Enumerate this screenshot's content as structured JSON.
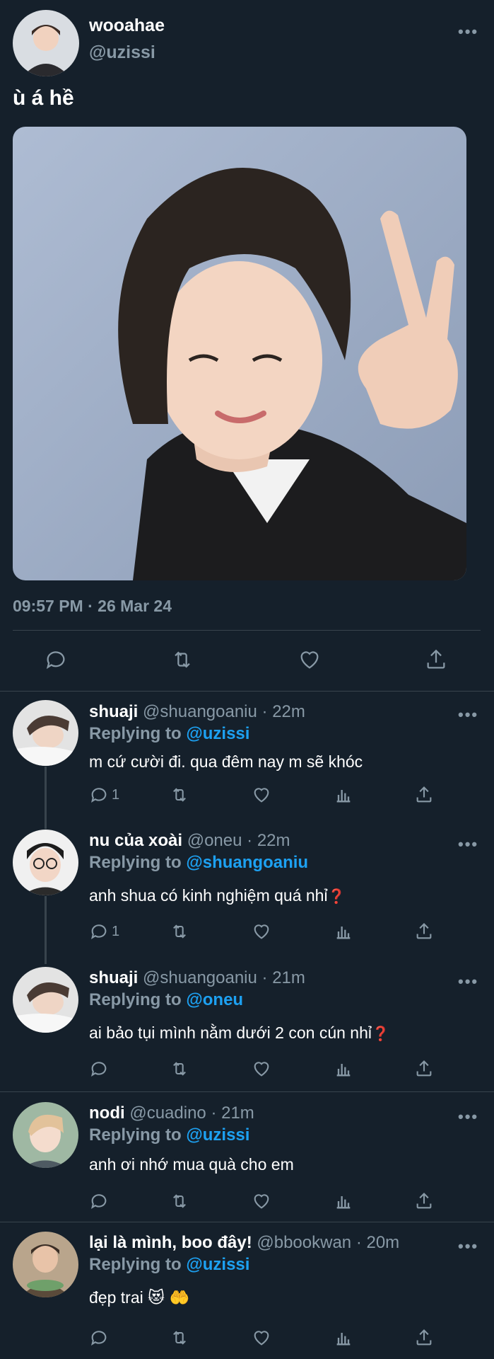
{
  "tweet": {
    "display_name": "wooahae",
    "handle": "@uzissi",
    "text": "ù á hề",
    "timestamp": "09:57 PM · 26 Mar 24",
    "more_label": "•••"
  },
  "replies": [
    {
      "name": "shuaji",
      "handle": "@shuangoaniu",
      "time": "· 22m",
      "replying_prefix": "Replying to",
      "replying_to": "@uzissi",
      "text": "m cứ cười đi. qua đêm nay m sẽ khóc",
      "reply_count": "1",
      "suffix": ""
    },
    {
      "name": "nu của xoài",
      "handle": "@oneu",
      "time": "· 22m",
      "replying_prefix": "Replying to",
      "replying_to": "@shuangoaniu",
      "text": "anh shua có kinh nghiệm quá nhỉ",
      "reply_count": "1",
      "suffix": "❓"
    },
    {
      "name": "shuaji",
      "handle": "@shuangoaniu",
      "time": "· 21m",
      "replying_prefix": "Replying to",
      "replying_to": "@oneu",
      "text": "ai bảo tụi mình nằm dưới 2 con cún nhỉ",
      "reply_count": "",
      "suffix": "❓"
    },
    {
      "name": "nodi",
      "handle": "@cuadino",
      "time": "· 21m",
      "replying_prefix": "Replying to",
      "replying_to": "@uzissi",
      "text": "anh ơi nhớ mua quà cho em",
      "reply_count": "",
      "suffix": ""
    },
    {
      "name": "lại là mình, boo đây!",
      "handle": "@bbookwan",
      "time": "· 20m",
      "replying_prefix": "Replying to",
      "replying_to": "@uzissi",
      "text": "đẹp trai 😻 🤲",
      "reply_count": "",
      "suffix": ""
    }
  ],
  "colors": {
    "background": "#15202b",
    "secondary_text": "#8899a6",
    "link": "#1da1f2",
    "divider": "#38444d"
  },
  "icons": [
    "reply-icon",
    "retweet-icon",
    "like-icon",
    "analytics-icon",
    "share-icon",
    "more-icon"
  ]
}
